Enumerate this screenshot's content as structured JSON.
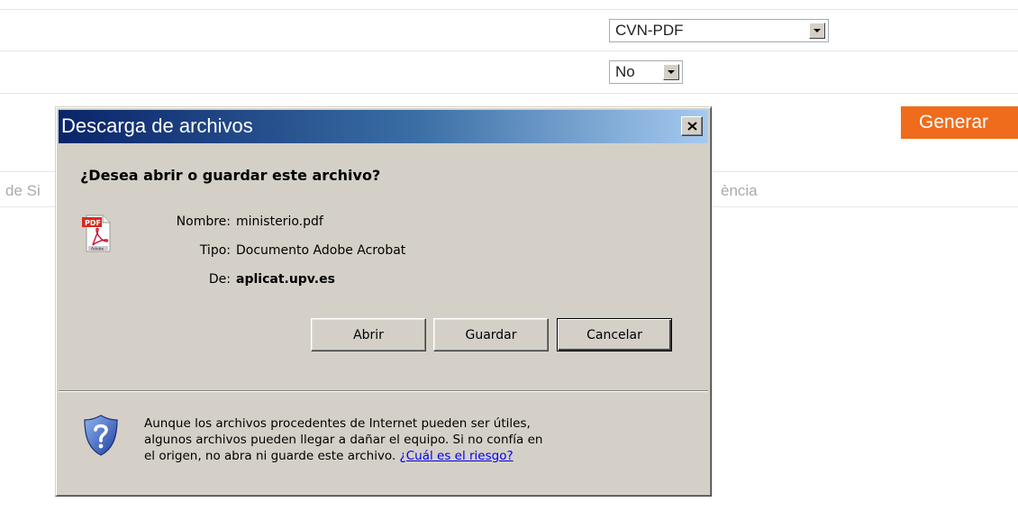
{
  "form": {
    "format_select": {
      "value": "CVN-PDF"
    },
    "option_select": {
      "value": "No"
    },
    "generate_label": "Generar",
    "table_headers": [
      "de Si",
      "ència"
    ]
  },
  "dialog": {
    "title": "Descarga de archivos",
    "question": "¿Desea abrir o guardar este archivo?",
    "file": {
      "name_label": "Nombre:",
      "name_value": "ministerio.pdf",
      "type_label": "Tipo:",
      "type_value": "Documento Adobe Acrobat",
      "from_label": "De:",
      "from_value": "aplicat.upv.es"
    },
    "buttons": {
      "open": "Abrir",
      "save": "Guardar",
      "cancel": "Cancelar"
    },
    "warning": {
      "line1": "Aunque los archivos procedentes de Internet pueden ser útiles,",
      "line2": "algunos archivos pueden llegar a dañar el equipo. Si no confía en",
      "line3": "el origen, no abra ni guarde este archivo.",
      "link": "¿Cuál es el riesgo?"
    },
    "icons": {
      "file": "pdf-file-icon",
      "warning": "shield-question-icon",
      "close": "close-icon"
    }
  },
  "colors": {
    "accent": "#ee6c1b",
    "titlebar": "#0a246a",
    "dialog_bg": "#d4d0c8",
    "link": "#0000ee"
  }
}
